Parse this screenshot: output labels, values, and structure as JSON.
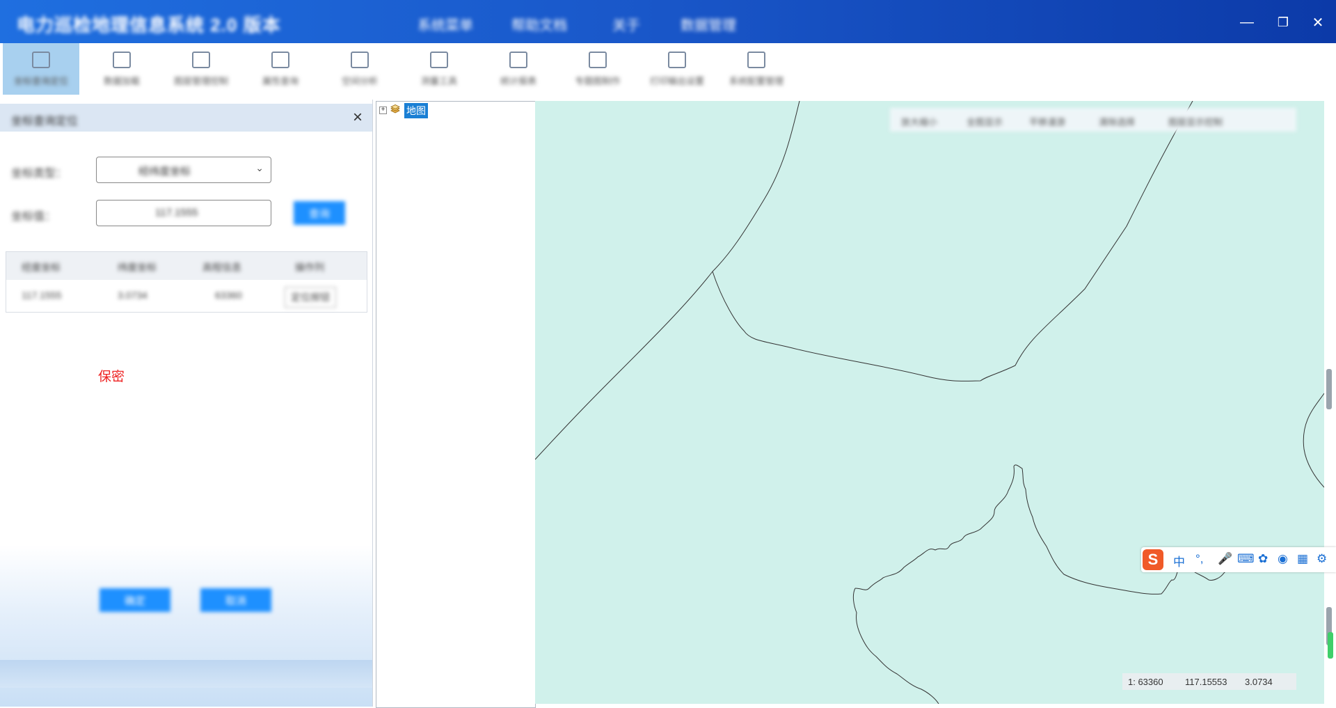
{
  "titlebar": {
    "title": "电力巡检地理信息系统 2.0 版本",
    "menus": [
      "系统菜单",
      "帮助文档",
      "关于",
      "数据管理"
    ],
    "minimize": "—",
    "restore": "❐",
    "close": "✕"
  },
  "toolbar": {
    "items": [
      {
        "label": "坐标查询定位",
        "icon": "locate-icon"
      },
      {
        "label": "数据加载",
        "icon": "load-icon"
      },
      {
        "label": "图层管理控制",
        "icon": "layer-icon"
      },
      {
        "label": "属性查询",
        "icon": "attribute-icon"
      },
      {
        "label": "空间分析",
        "icon": "analysis-icon"
      },
      {
        "label": "测量工具",
        "icon": "measure-icon"
      },
      {
        "label": "统计报表",
        "icon": "report-icon"
      },
      {
        "label": "专题图制作",
        "icon": "thematic-icon"
      },
      {
        "label": "打印输出设置",
        "icon": "print-icon"
      },
      {
        "label": "系统配置管理",
        "icon": "config-icon"
      }
    ]
  },
  "left_panel": {
    "title": "坐标查询定位",
    "type_label": "坐标类型：",
    "type_value": "经纬度坐标",
    "coord_label": "坐标值：",
    "coord_value": "117.1555",
    "query_button": "查询",
    "table": {
      "headers": [
        "经度坐标",
        "纬度坐标",
        "高程信息",
        "操作列"
      ],
      "rows": [
        [
          "117.1555",
          "3.0734",
          "63360",
          "定位按钮"
        ]
      ]
    },
    "secret_text": "保密",
    "ok_button": "确定",
    "cancel_button": "取消"
  },
  "tree": {
    "root_label": "地图"
  },
  "map_toolbar": {
    "items": [
      "放大缩小",
      "全图显示",
      "平移漫游",
      "清除选择",
      "图层显示控制"
    ]
  },
  "status_bar": {
    "scale": "1: 63360",
    "x": "117.15553",
    "y": "3.0734"
  },
  "ime": {
    "logo": "S",
    "mode": "中",
    "punct": "°,"
  },
  "colors": {
    "titlebar": "#1956c8",
    "accent": "#1e90ff",
    "map_bg": "#d0f1eb",
    "secret": "#ee2222"
  }
}
